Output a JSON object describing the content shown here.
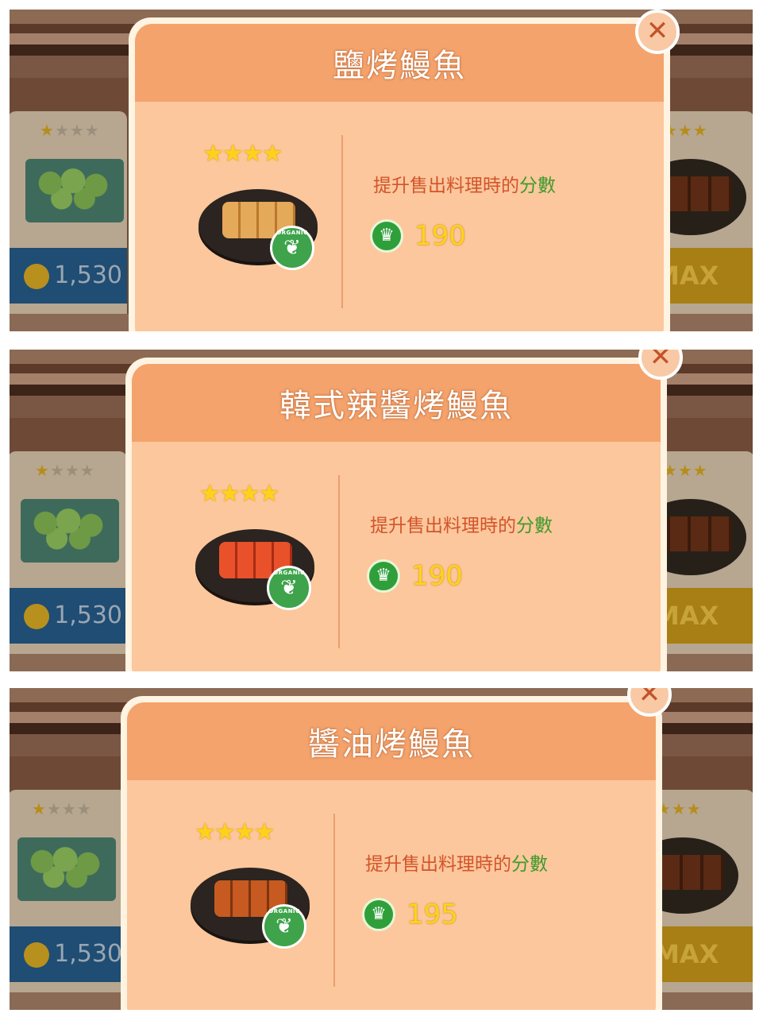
{
  "panels": [
    {
      "title": "鹽烤鰻魚",
      "stars": "★★★★",
      "desc_prefix": "提升售出料理時的",
      "desc_highlight": "分數",
      "score": "190",
      "badge_label": "ORGANIC",
      "dish_icon": "salt-grilled-eel-icon",
      "bg_price": "1,530",
      "bg_max": "MAX",
      "bg_left_stars": {
        "on": "★",
        "off": "★★★"
      },
      "bg_right_stars": "★★★★"
    },
    {
      "title": "韓式辣醬烤鰻魚",
      "stars": "★★★★",
      "desc_prefix": "提升售出料理時的",
      "desc_highlight": "分數",
      "score": "190",
      "badge_label": "ORGANIC",
      "dish_icon": "spicy-grilled-eel-icon",
      "bg_price": "1,530",
      "bg_max": "MAX",
      "bg_left_stars": {
        "on": "★",
        "off": "★★★"
      },
      "bg_right_stars": "★★★★"
    },
    {
      "title": "醬油烤鰻魚",
      "stars": "★★★★",
      "desc_prefix": "提升售出料理時的",
      "desc_highlight": "分數",
      "score": "195",
      "badge_label": "ORGANIC",
      "dish_icon": "soy-grilled-eel-icon",
      "bg_price": "1,530",
      "bg_max": "MAX",
      "bg_left_stars": {
        "on": "★",
        "off": "★★★"
      },
      "bg_right_stars": "★★★★"
    }
  ],
  "icons": {
    "close": "✕",
    "crown": "♛",
    "leaf": "❦"
  },
  "colors": {
    "header": "#f4a36d",
    "body": "#fcc79c",
    "desc_text": "#d2542b",
    "highlight": "#3f9a2e",
    "score": "#ffd21a"
  }
}
